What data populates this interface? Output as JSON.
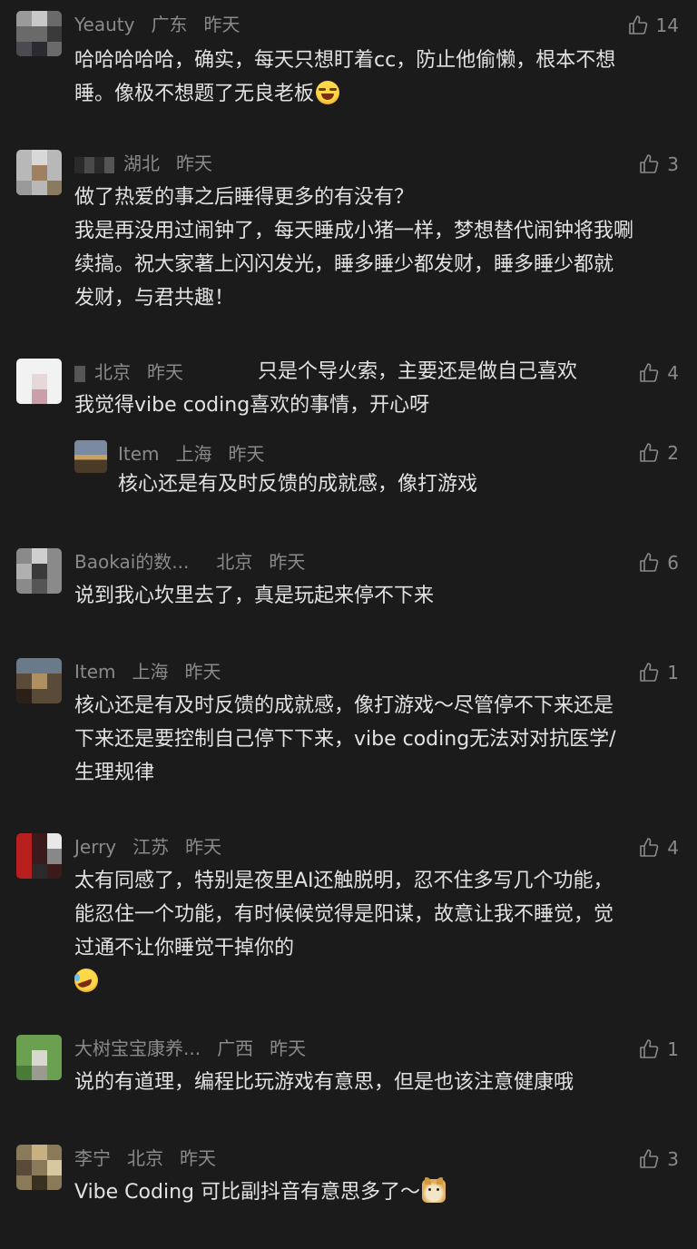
{
  "comments": [
    {
      "user": "Yeauty",
      "location": "广东",
      "time": "昨天",
      "likes": "14",
      "lines": [
        "哈哈哈哈哈，确实，每天只想盯着cc，防止他偷懒，根本不想",
        "睡。像极不想题了无良老板"
      ],
      "emoji": "laughing-crying-emoji"
    },
    {
      "user": "",
      "location": "湖北",
      "time": "昨天",
      "likes": "3",
      "lines": [
        "做了热爱的事之后睡得更多的有没有？",
        "我是再没用过闹钟了，每天睡成小猪一样，梦想替代闹钟将我唰",
        "续搞。祝大家著上闪闪发光，睡多睡少都发财，睡多睡少都就",
        "发财，与君共趣！"
      ]
    },
    {
      "user": "",
      "location": "北京",
      "time": "昨天",
      "likes": "4",
      "inline_text": "只是个导火索，主要还是做自己喜欢",
      "lines": [
        "我觉得vibe coding喜欢的事情，开心呀"
      ],
      "reply": {
        "user": "Item",
        "location": "上海",
        "time": "昨天",
        "likes": "2",
        "lines": [
          "核心还是有及时反馈的成就感，像打游戏"
        ]
      }
    },
    {
      "user": "Baokai的数...",
      "location": "北京",
      "time": "昨天",
      "likes": "6",
      "lines": [
        "说到我心坎里去了，真是玩起来停不下来"
      ]
    },
    {
      "user": "Item",
      "location": "上海",
      "time": "昨天",
      "likes": "1",
      "lines": [
        "核心还是有及时反馈的成就感，像打游戏～尽管停不下来还是",
        "下来还是要控制自己停下下来，vibe coding无法对对抗医学/",
        "生理规律"
      ]
    },
    {
      "user": "Jerry",
      "location": "江苏",
      "time": "昨天",
      "likes": "4",
      "lines": [
        "太有同感了，特别是夜里AI还触脱明，忍不住多写几个功能，",
        "能忍住一个功能，有时候候觉得是阳谋，故意让我不睡觉，觉",
        "过通不让你睡觉干掉你的"
      ],
      "emoji_line": "laughing-rolling-emoji"
    },
    {
      "user": "大树宝宝康养...",
      "location": "广西",
      "time": "昨天",
      "likes": "1",
      "lines": [
        "说的有道理，编程比玩游戏有意思，但是也该注意健康哦"
      ]
    },
    {
      "user": "李宁",
      "location": "北京",
      "time": "昨天",
      "likes": "3",
      "lines": [
        "Vibe Coding 可比副抖音有意思多了～"
      ],
      "emoji": "doge-emoji"
    }
  ]
}
